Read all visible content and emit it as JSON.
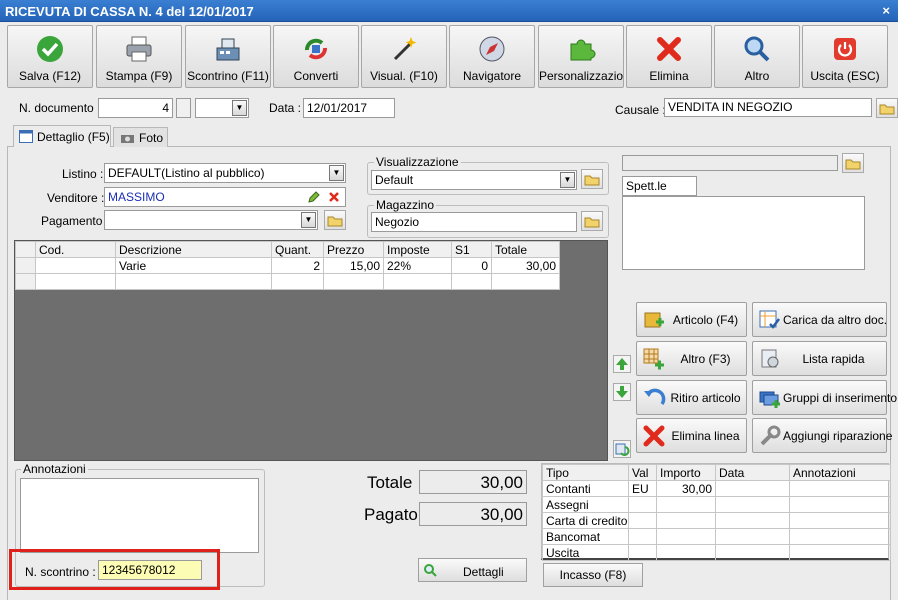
{
  "window": {
    "title": "RICEVUTA DI CASSA N. 4 del 12/01/2017",
    "close": "×"
  },
  "toolbar": [
    {
      "label": "Salva (F12)",
      "icon": "check-icon"
    },
    {
      "label": "Stampa (F9)",
      "icon": "printer-icon"
    },
    {
      "label": "Scontrino (F11)",
      "icon": "cash-register-icon"
    },
    {
      "label": "Converti",
      "icon": "convert-icon"
    },
    {
      "label": "Visual. (F10)",
      "icon": "magic-wand-icon"
    },
    {
      "label": "Navigatore",
      "icon": "compass-icon"
    },
    {
      "label": "Personalizzazioni",
      "icon": "puzzle-icon"
    },
    {
      "label": "Elimina",
      "icon": "red-x-icon"
    },
    {
      "label": "Altro",
      "icon": "magnifier-icon"
    },
    {
      "label": "Uscita (ESC)",
      "icon": "power-icon"
    }
  ],
  "header": {
    "ndoc_label": "N. documento :",
    "ndoc_value": "4",
    "data_label": "Data :",
    "data_value": "12/01/2017",
    "causale_label": "Causale :",
    "causale_value": "VENDITA IN NEGOZIO"
  },
  "tabs": {
    "dettaglio": "Dettaglio (F5)",
    "foto": "Foto"
  },
  "form": {
    "listino_label": "Listino :",
    "listino_value": "DEFAULT(Listino al pubblico)",
    "venditore_label": "Venditore :",
    "venditore_value": "MASSIMO",
    "pagamento_label": "Pagamento :",
    "pagamento_value": ""
  },
  "visualizzazione": {
    "title": "Visualizzazione",
    "value": "Default"
  },
  "magazzino": {
    "title": "Magazzino",
    "value": "Negozio"
  },
  "customer": {
    "spett": "Spett.le"
  },
  "grid": {
    "headers": [
      "Cod.",
      "Descrizione",
      "Quant.",
      "Prezzo",
      "Imposte",
      "S1",
      "Totale"
    ],
    "rows": [
      [
        "",
        "Varie",
        "2",
        "15,00",
        "22%",
        "0",
        "30,00"
      ],
      [
        "",
        "",
        "",
        "",
        "",
        "",
        ""
      ]
    ]
  },
  "actions": {
    "articolo": "Articolo (F4)",
    "carica": "Carica da altro doc.",
    "altro": "Altro (F3)",
    "lista": "Lista rapida",
    "ritiro": "Ritiro articolo",
    "gruppi": "Gruppi di inserimento",
    "elimina_linea": "Elimina linea",
    "riparazione": "Aggiungi riparazione"
  },
  "annotazioni": {
    "title": "Annotazioni",
    "scontrino_label": "N. scontrino :",
    "scontrino_value": "12345678012"
  },
  "totals": {
    "totale_label": "Totale",
    "totale_value": "30,00",
    "pagato_label": "Pagato",
    "pagato_value": "30,00",
    "dettagli": "Dettagli"
  },
  "payments": {
    "headers": [
      "Tipo",
      "Val",
      "Importo",
      "Data",
      "Annotazioni"
    ],
    "rows": [
      [
        "Contanti",
        "EU",
        "30,00",
        "",
        ""
      ],
      [
        "Assegni",
        "",
        "",
        "",
        ""
      ],
      [
        "Carta di credito",
        "",
        "",
        "",
        ""
      ],
      [
        "Bancomat",
        "",
        "",
        "",
        ""
      ],
      [
        "Uscita",
        "",
        "",
        "",
        ""
      ]
    ],
    "incasso": "Incasso (F8)"
  }
}
